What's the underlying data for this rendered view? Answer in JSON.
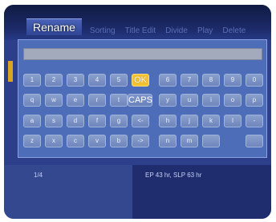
{
  "menu": {
    "active_tab": "Rename",
    "tabs": [
      "Sorting",
      "Title Edit",
      "Divide",
      "Play",
      "Delete"
    ]
  },
  "keyboard": {
    "rows": [
      [
        "1",
        "2",
        "3",
        "4",
        "5",
        "OK",
        "6",
        "7",
        "8",
        "9",
        "0"
      ],
      [
        "q",
        "w",
        "e",
        "r",
        "t",
        "CAPS",
        "y",
        "u",
        "i",
        "o",
        "p"
      ],
      [
        "a",
        "s",
        "d",
        "f",
        "g",
        "<-",
        "h",
        "j",
        "k",
        "l",
        "-"
      ],
      [
        "z",
        "x",
        "c",
        "v",
        "b",
        "->",
        "n",
        "m",
        "",
        ""
      ]
    ],
    "highlighted": "OK"
  },
  "footer": {
    "page": "1/4",
    "info": "EP 43 hr,   SLP 63 hr"
  },
  "colors": {
    "background": "#2d3f8a",
    "dialog": "#4d6db8",
    "highlight": "#f2c230"
  }
}
